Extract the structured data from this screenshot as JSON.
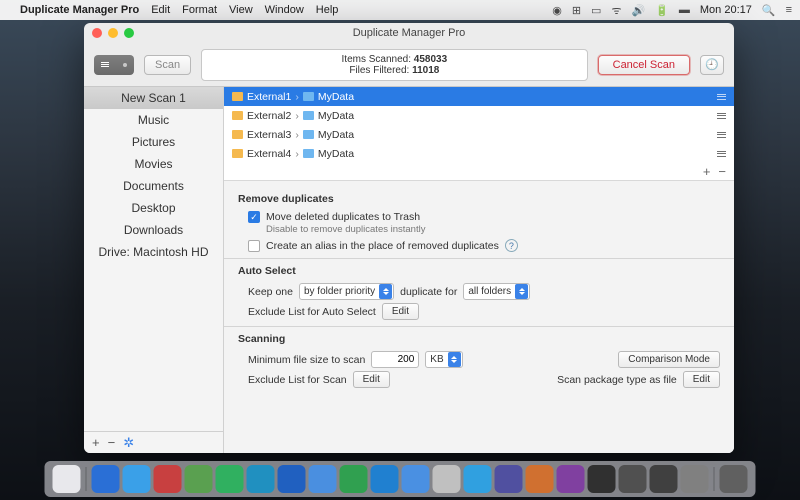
{
  "menubar": {
    "app_name": "Duplicate Manager Pro",
    "items": [
      "Edit",
      "Format",
      "View",
      "Window",
      "Help"
    ],
    "clock": "Mon 20:17"
  },
  "window": {
    "title": "Duplicate Manager Pro"
  },
  "toolbar": {
    "scan_label": "Scan",
    "status_line1_label": "Items Scanned:",
    "status_line1_value": "458033",
    "status_line2_label": "Files Filtered:",
    "status_line2_value": "11018",
    "cancel_label": "Cancel Scan"
  },
  "sidebar": {
    "items": [
      {
        "label": "New Scan 1",
        "selected": true
      },
      {
        "label": "Music"
      },
      {
        "label": "Pictures"
      },
      {
        "label": "Movies"
      },
      {
        "label": "Documents"
      },
      {
        "label": "Desktop"
      },
      {
        "label": "Downloads"
      },
      {
        "label": "Drive: Macintosh HD"
      }
    ]
  },
  "paths": [
    {
      "drive": "External1",
      "folder": "MyData",
      "selected": true
    },
    {
      "drive": "External2",
      "folder": "MyData"
    },
    {
      "drive": "External3",
      "folder": "MyData"
    },
    {
      "drive": "External4",
      "folder": "MyData"
    }
  ],
  "settings": {
    "remove_title": "Remove duplicates",
    "move_trash_label": "Move deleted duplicates to Trash",
    "move_trash_hint": "Disable to remove duplicates instantly",
    "create_alias_label": "Create an alias in the place of removed duplicates",
    "autoselect_title": "Auto Select",
    "keep_one_label": "Keep one",
    "keep_one_value": "by folder priority",
    "duplicate_for_label": "duplicate for",
    "duplicate_for_value": "all folders",
    "exclude_auto_label": "Exclude List for Auto Select",
    "edit_label": "Edit",
    "scanning_title": "Scanning",
    "min_size_label": "Minimum file size to scan",
    "min_size_value": "200",
    "min_size_unit": "KB",
    "comparison_mode_label": "Comparison Mode",
    "exclude_scan_label": "Exclude List for Scan",
    "scan_pkg_label": "Scan package type as file"
  },
  "dock_colors": [
    "#e8e8ec",
    "#2a6fd6",
    "#3aa0e8",
    "#c84040",
    "#5aa050",
    "#30b060",
    "#2090c0",
    "#2060c0",
    "#4a8fe0",
    "#30a050",
    "#2080d0",
    "#4a90e2",
    "#c0c0c0",
    "#30a0e0",
    "#5050a0",
    "#d07030",
    "#8040a0",
    "#303030",
    "#505050",
    "#404040",
    "#808080",
    "#606060"
  ]
}
